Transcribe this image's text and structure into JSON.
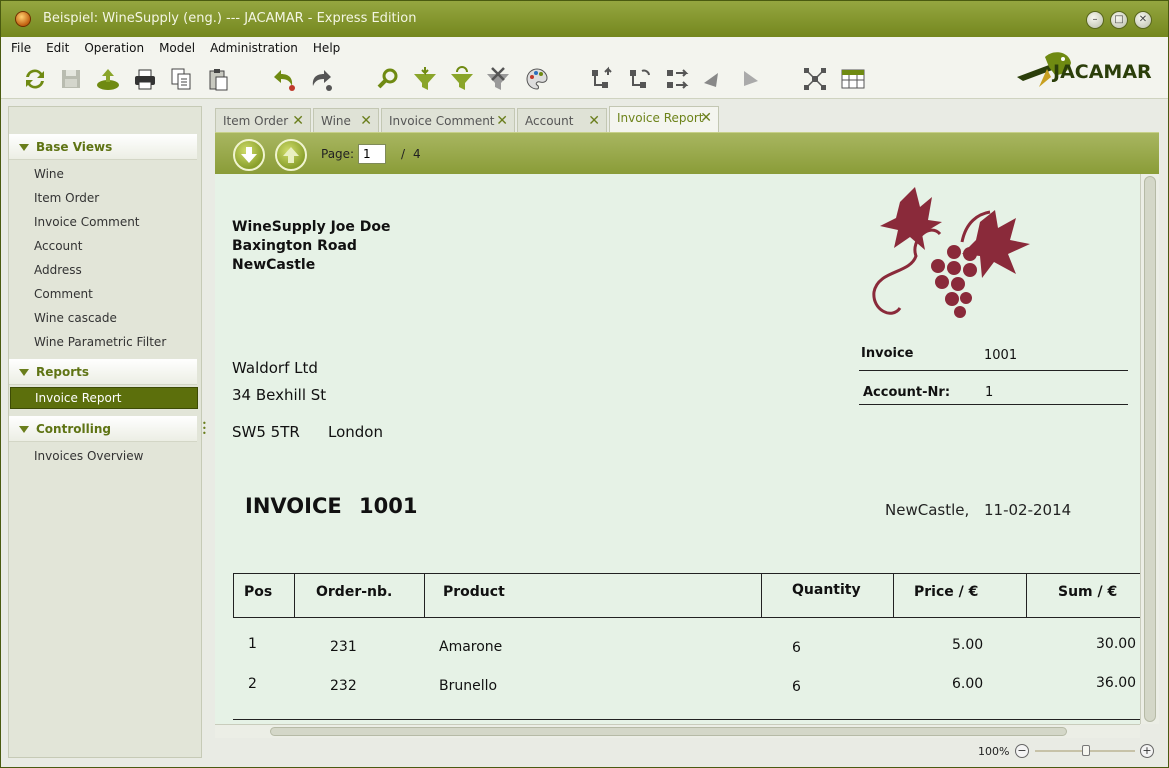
{
  "window": {
    "title": "Beispiel: WineSupply (eng.) --- JACAMAR - Express Edition",
    "buttons": {
      "minimize": "–",
      "maximize": "□",
      "close": "✕"
    }
  },
  "menu": [
    "File",
    "Edit",
    "Operation",
    "Model",
    "Administration",
    "Help"
  ],
  "toolbar": [
    {
      "name": "refresh-icon"
    },
    {
      "name": "save-icon"
    },
    {
      "name": "export-icon"
    },
    {
      "name": "print-icon"
    },
    {
      "name": "copy-icon"
    },
    {
      "name": "paste-icon"
    },
    {
      "name": "undo-icon"
    },
    {
      "name": "redo-icon"
    },
    {
      "name": "search-icon"
    },
    {
      "name": "filter-icon"
    },
    {
      "name": "filter-refresh-icon"
    },
    {
      "name": "filter-clear-icon"
    },
    {
      "name": "palette-icon"
    },
    {
      "name": "tree-up-icon"
    },
    {
      "name": "tree-sync-icon"
    },
    {
      "name": "tree-move-icon"
    },
    {
      "name": "arrow-left-icon"
    },
    {
      "name": "arrow-right-icon"
    },
    {
      "name": "network-icon"
    },
    {
      "name": "table-icon"
    }
  ],
  "logo": {
    "text": "JACAMAR"
  },
  "sidebar": {
    "groups": [
      {
        "label": "Base Views",
        "items": [
          "Wine",
          "Item Order",
          "Invoice Comment",
          "Account",
          "Address",
          "Comment",
          "Wine cascade",
          "Wine Parametric Filter"
        ]
      },
      {
        "label": "Reports",
        "items": [
          "Invoice Report"
        ]
      },
      {
        "label": "Controlling",
        "items": [
          "Invoices Overview"
        ]
      }
    ],
    "selected": "Invoice Report"
  },
  "tabs": [
    {
      "label": "Item Order"
    },
    {
      "label": "Wine"
    },
    {
      "label": "Invoice Comment"
    },
    {
      "label": "Account"
    },
    {
      "label": "Invoice Report",
      "active": true
    }
  ],
  "pager": {
    "label": "Page:",
    "current": "1",
    "separator": "/",
    "total": "4"
  },
  "report": {
    "sender": [
      "WineSupply Joe Doe",
      "Baxington Road",
      "NewCastle"
    ],
    "recipient": {
      "name": "Waldorf Ltd",
      "street": "34 Bexhill St",
      "postcode": "SW5 5TR",
      "city": "London"
    },
    "invoice_label": "Invoice",
    "invoice_value": "1001",
    "account_label": "Account-Nr:",
    "account_value": "1",
    "title": "INVOICE",
    "title_number": "1001",
    "place": "NewCastle,",
    "date": "11-02-2014",
    "columns": [
      "Pos",
      "Order-nb.",
      "Product",
      "Quantity",
      "Price / €",
      "Sum / €"
    ],
    "rows": [
      {
        "pos": "1",
        "order": "231",
        "product": "Amarone",
        "qty": "6",
        "price": "5.00",
        "sum": "30.00"
      },
      {
        "pos": "2",
        "order": "232",
        "product": "Brunello",
        "qty": "6",
        "price": "6.00",
        "sum": "36.00"
      }
    ],
    "colors": {
      "logo": "#8a2a3a",
      "background": "#e6f2e6"
    }
  },
  "status": {
    "zoom": "100%",
    "zoom_out": "−",
    "zoom_in": "+"
  }
}
